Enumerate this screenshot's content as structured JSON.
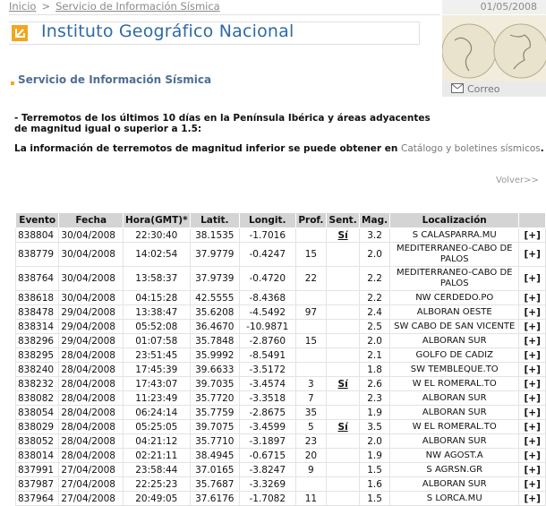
{
  "breadcrumb": {
    "home": "Inicio",
    "separator": ">",
    "current": "Servicio de Información Sísmica"
  },
  "date": "01/05/2008",
  "correo_label": "Correo",
  "header": {
    "title": "Instituto Geográfico Nacional"
  },
  "subtitle": "Servicio de Información Sísmica",
  "description": "- Terremotos de los últimos 10 días en la Península Ibérica y áreas adyacentes de magnitud igual o superior a 1.5:",
  "info_prefix": "La información de terremotos de magnitud inferior se puede obtener en",
  "info_link": "Catálogo y boletines sísmicos",
  "info_suffix": ".",
  "volver": "Volver>>",
  "table": {
    "headers": [
      "Evento",
      "Fecha",
      "Hora(GMT)*",
      "Latit.",
      "Longit.",
      "Prof.",
      "Sent.",
      "Mag.",
      "Localización",
      ""
    ],
    "rows": [
      [
        "838804",
        "30/04/2008",
        "22:30:40",
        "38.1535",
        "-1.7016",
        "",
        "Sí",
        "3.2",
        "S CALASPARRA.MU",
        "[+]"
      ],
      [
        "838779",
        "30/04/2008",
        "14:02:54",
        "37.9779",
        "-0.4247",
        "15",
        "",
        "2.0",
        "MEDITERRANEO-CABO DE PALOS",
        "[+]"
      ],
      [
        "838764",
        "30/04/2008",
        "13:58:37",
        "37.9739",
        "-0.4720",
        "22",
        "",
        "2.2",
        "MEDITERRANEO-CABO DE PALOS",
        "[+]"
      ],
      [
        "838618",
        "30/04/2008",
        "04:15:28",
        "42.5555",
        "-8.4368",
        "",
        "",
        "2.2",
        "NW CERDEDO.PO",
        "[+]"
      ],
      [
        "838478",
        "29/04/2008",
        "13:38:47",
        "35.6208",
        "-4.5492",
        "97",
        "",
        "2.4",
        "ALBORAN OESTE",
        "[+]"
      ],
      [
        "838314",
        "29/04/2008",
        "05:52:08",
        "36.4670",
        "-10.9871",
        "",
        "",
        "2.5",
        "SW CABO DE SAN VICENTE",
        "[+]"
      ],
      [
        "838296",
        "29/04/2008",
        "01:07:58",
        "35.7848",
        "-2.8760",
        "15",
        "",
        "2.0",
        "ALBORAN SUR",
        "[+]"
      ],
      [
        "838295",
        "28/04/2008",
        "23:51:45",
        "35.9992",
        "-8.5491",
        "",
        "",
        "2.1",
        "GOLFO DE CADIZ",
        "[+]"
      ],
      [
        "838240",
        "28/04/2008",
        "17:45:39",
        "39.6633",
        "-3.5172",
        "",
        "",
        "1.8",
        "SW TEMBLEQUE.TO",
        "[+]"
      ],
      [
        "838232",
        "28/04/2008",
        "17:43:07",
        "39.7035",
        "-3.4574",
        "3",
        "Sí",
        "2.6",
        "W EL ROMERAL.TO",
        "[+]"
      ],
      [
        "838082",
        "28/04/2008",
        "11:23:49",
        "35.7720",
        "-3.3518",
        "7",
        "",
        "2.3",
        "ALBORAN SUR",
        "[+]"
      ],
      [
        "838054",
        "28/04/2008",
        "06:24:14",
        "35.7759",
        "-2.8675",
        "35",
        "",
        "1.9",
        "ALBORAN SUR",
        "[+]"
      ],
      [
        "838029",
        "28/04/2008",
        "05:25:05",
        "39.7075",
        "-3.4599",
        "5",
        "Sí",
        "3.5",
        "W EL ROMERAL.TO",
        "[+]"
      ],
      [
        "838052",
        "28/04/2008",
        "04:21:12",
        "35.7710",
        "-3.1897",
        "23",
        "",
        "2.0",
        "ALBORAN SUR",
        "[+]"
      ],
      [
        "838014",
        "28/04/2008",
        "02:21:11",
        "38.4945",
        "-0.6715",
        "20",
        "",
        "1.9",
        "NW AGOST.A",
        "[+]"
      ],
      [
        "837991",
        "27/04/2008",
        "23:58:44",
        "37.0165",
        "-3.8247",
        "9",
        "",
        "1.5",
        "S AGRSN.GR",
        "[+]"
      ],
      [
        "837987",
        "27/04/2008",
        "22:25:23",
        "35.7687",
        "-3.3269",
        "",
        "",
        "1.6",
        "ALBORAN SUR",
        "[+]"
      ],
      [
        "837964",
        "27/04/2008",
        "20:49:05",
        "37.6176",
        "-1.7082",
        "11",
        "",
        "1.5",
        "S LORCA.MU",
        "[+]"
      ]
    ]
  }
}
